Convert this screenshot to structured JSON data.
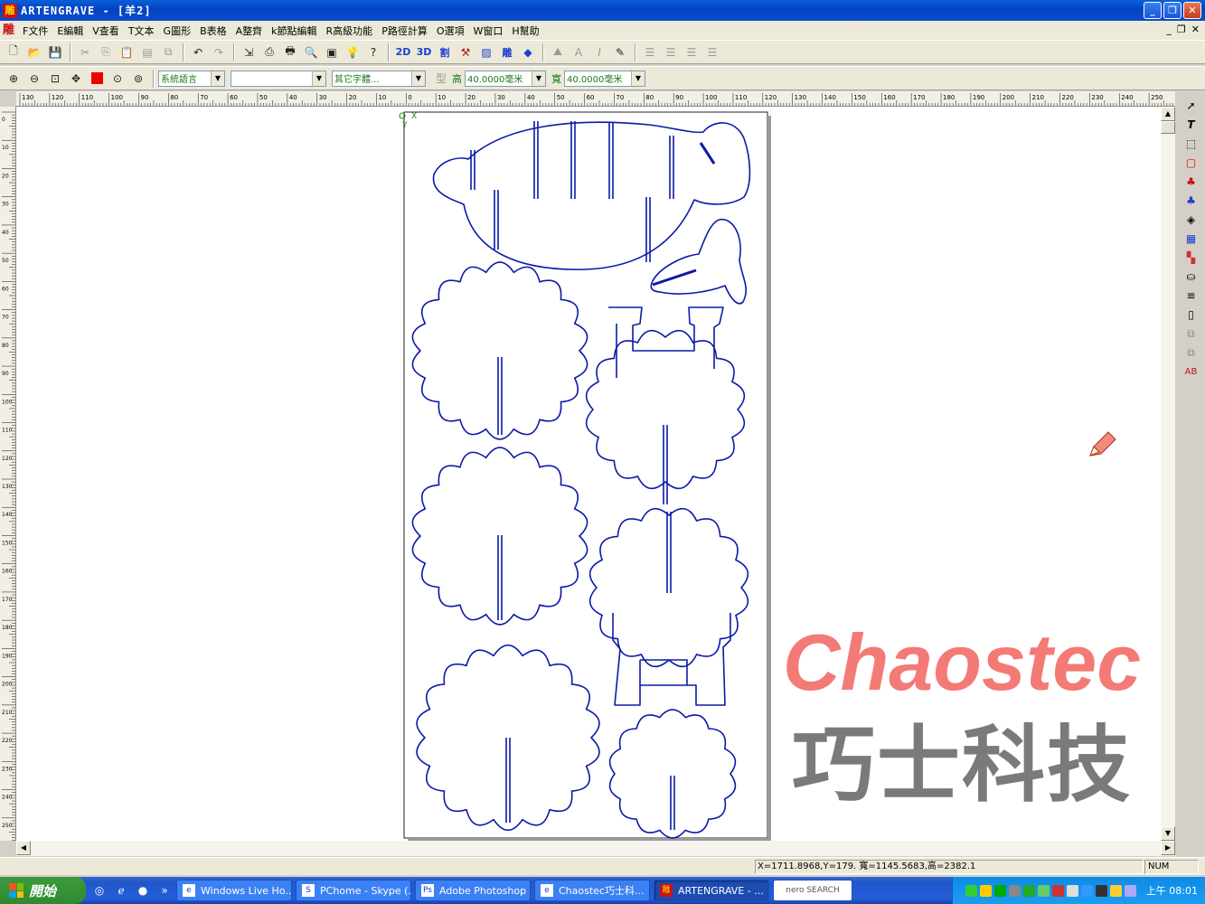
{
  "window": {
    "title": "ARTENGRAVE - [羊2]"
  },
  "menu": {
    "logo": "雕",
    "items": [
      "F文件",
      "E編輯",
      "V查看",
      "T文本",
      "G圖形",
      "B表格",
      "A整齊",
      "k節點編輯",
      "R高級功能",
      "P路徑計算",
      "O選項",
      "W窗口",
      "H幫助"
    ]
  },
  "toolbar1": {
    "btn_2d": "2D",
    "btn_3d": "3D",
    "btn_cut": "割",
    "btn_engrave": "雕"
  },
  "toolbar2": {
    "language_combo": "系統語言",
    "font_combo": "",
    "other_font_combo": "其它字體...",
    "type_label": "型",
    "height_label": "高",
    "height_value": "40.0000毫米",
    "width_label": "寬",
    "width_value": "40.0000毫米"
  },
  "ruler": {
    "h_labels": [
      "130",
      "120",
      "110",
      "100",
      "90",
      "80",
      "70",
      "60",
      "50",
      "40",
      "30",
      "20",
      "10",
      "0",
      "10",
      "20",
      "30",
      "40",
      "50",
      "60",
      "70",
      "80",
      "90",
      "100",
      "110",
      "120",
      "130",
      "140",
      "150",
      "160",
      "170",
      "180",
      "190",
      "200",
      "210",
      "220",
      "230",
      "240",
      "250"
    ],
    "v_labels": [
      "0",
      "10",
      "20",
      "30",
      "40",
      "50",
      "60",
      "70",
      "80",
      "90",
      "100",
      "110",
      "120",
      "130",
      "140",
      "150",
      "160",
      "170",
      "180",
      "190",
      "200",
      "210",
      "220",
      "230",
      "240",
      "250"
    ]
  },
  "canvas": {
    "origin_x": "X",
    "origin_y": "Y"
  },
  "watermark": {
    "brand_en": "Chaostec",
    "brand_zh": "巧士科技"
  },
  "status": {
    "coords": "X=1711.8968,Y=179.  寬=1145.5683,高=2382.1",
    "num": "NUM"
  },
  "taskbar": {
    "start": "開始",
    "tasks": [
      {
        "label": "Windows Live Ho...",
        "icon": "ie"
      },
      {
        "label": "PChome - Skype (...",
        "icon": "S"
      },
      {
        "label": "Adobe Photoshop ...",
        "icon": "Ps"
      },
      {
        "label": "Chaostec巧士科...",
        "icon": "ie"
      },
      {
        "label": "ARTENGRAVE - ...",
        "icon": "雕",
        "active": true
      }
    ],
    "nero": "nero SEARCH",
    "clock": "上午 08:01"
  },
  "colors": {
    "shape_stroke": "#0a1aa8",
    "brand_red": "#f47a76",
    "brand_gray": "#7a7a7a"
  }
}
